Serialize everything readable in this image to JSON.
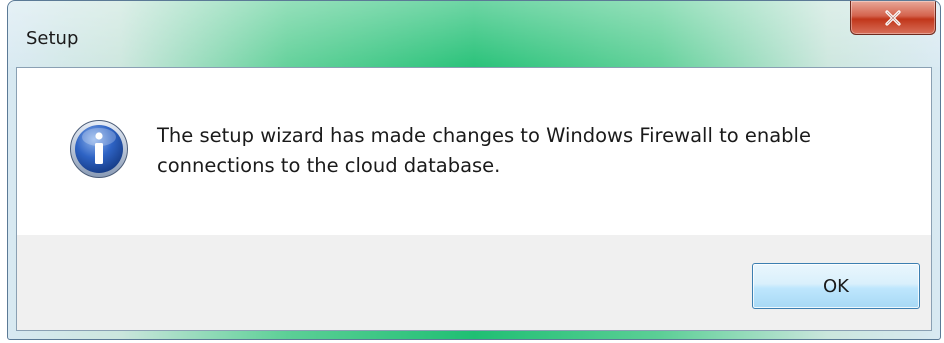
{
  "window": {
    "title": "Setup"
  },
  "dialog": {
    "icon": "information-icon",
    "message": "The setup wizard has made changes to Windows Firewall to enable connections to the cloud database."
  },
  "buttons": {
    "ok_label": "OK"
  },
  "colors": {
    "title_gradient_center": "#1fbf73",
    "close_button": "#c1361a",
    "ok_button_border": "#3c7fb1",
    "button_area_bg": "#f0f0f0"
  }
}
